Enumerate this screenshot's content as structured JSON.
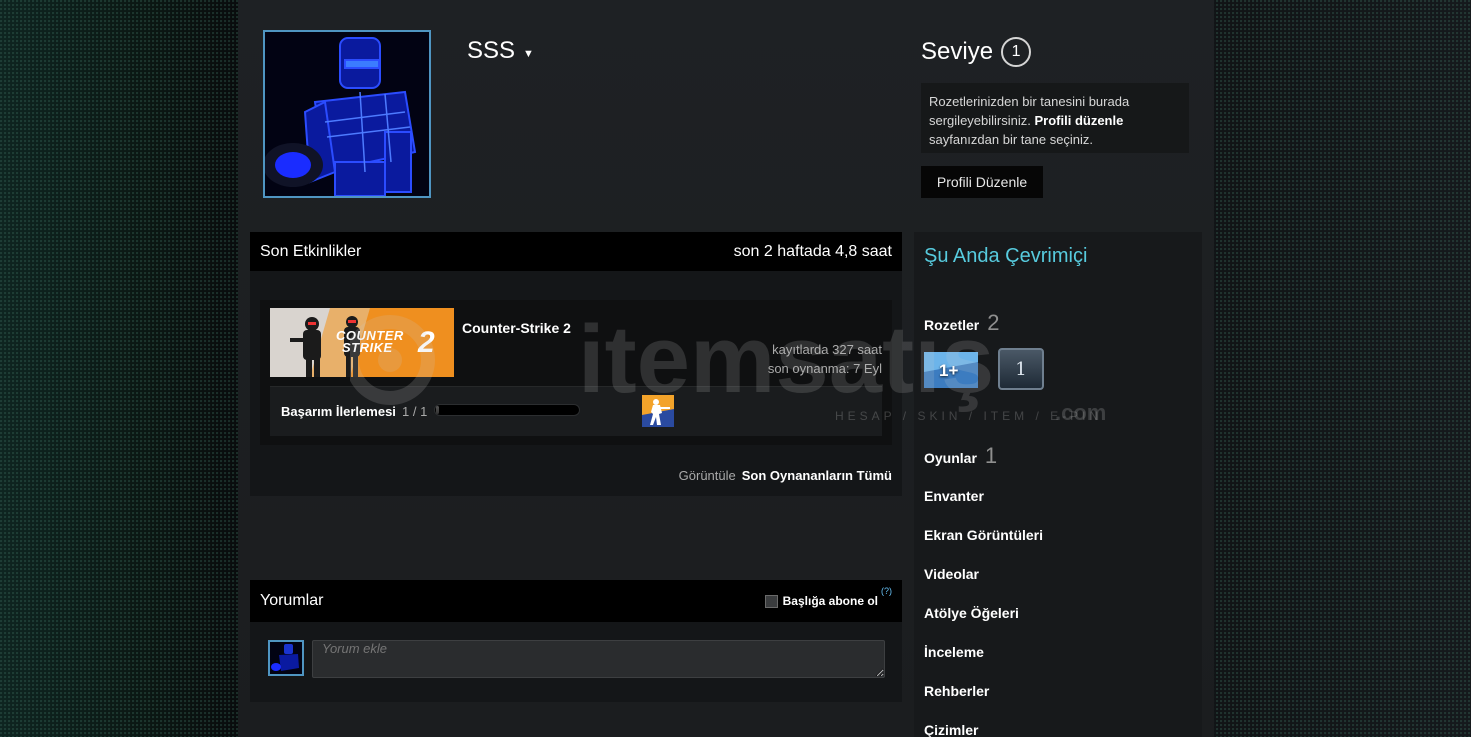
{
  "profile": {
    "username": "SSS",
    "level_label": "Seviye",
    "level_value": "1",
    "showcase_text_1": "Rozetlerinizden bir tanesini burada sergileyebilirsiniz.",
    "showcase_link": "Profili düzenle",
    "showcase_text_2": "sayfanızdan bir tane seçiniz.",
    "edit_button": "Profili Düzenle"
  },
  "activity": {
    "title": "Son Etkinlikler",
    "summary": "son 2 haftada 4,8 saat",
    "game": {
      "name": "Counter-Strike 2",
      "capsule_text_1": "COUNTER",
      "capsule_text_2": "STRIKE",
      "capsule_text_3": "2",
      "hours_on_record": "kayıtlarda 327 saat",
      "last_played": "son oynanma: 7 Eyl",
      "achievement_label": "Başarım İlerlemesi",
      "achievement_count": "1 / 1",
      "achievement_progress": 0.02
    },
    "view_label": "Görüntüle",
    "view_link": "Son Oynananların Tümü"
  },
  "comments": {
    "title": "Yorumlar",
    "subscribe_label": "Başlığa abone ol",
    "help_label": "(?)",
    "placeholder": "Yorum ekle"
  },
  "sidebar": {
    "status": "Şu Anda Çevrimiçi",
    "badges_label": "Rozetler",
    "badges_count": "2",
    "badge1_text": "1+",
    "badge2_text": "1",
    "games_label": "Oyunlar",
    "games_count": "1",
    "items": [
      "Envanter",
      "Ekran Görüntüleri",
      "Videolar",
      "Atölye Öğeleri",
      "İnceleme",
      "Rehberler",
      "Çizimler"
    ]
  },
  "watermark": {
    "brand": "itemsatış",
    "tagline": "HESAP / SKIN / ITEM / E-PIN",
    "suffix": ".com"
  },
  "colors": {
    "online": "#57cbde",
    "avatar_border": "#4f95c2",
    "cs2_orange": "#ef8f1f"
  }
}
